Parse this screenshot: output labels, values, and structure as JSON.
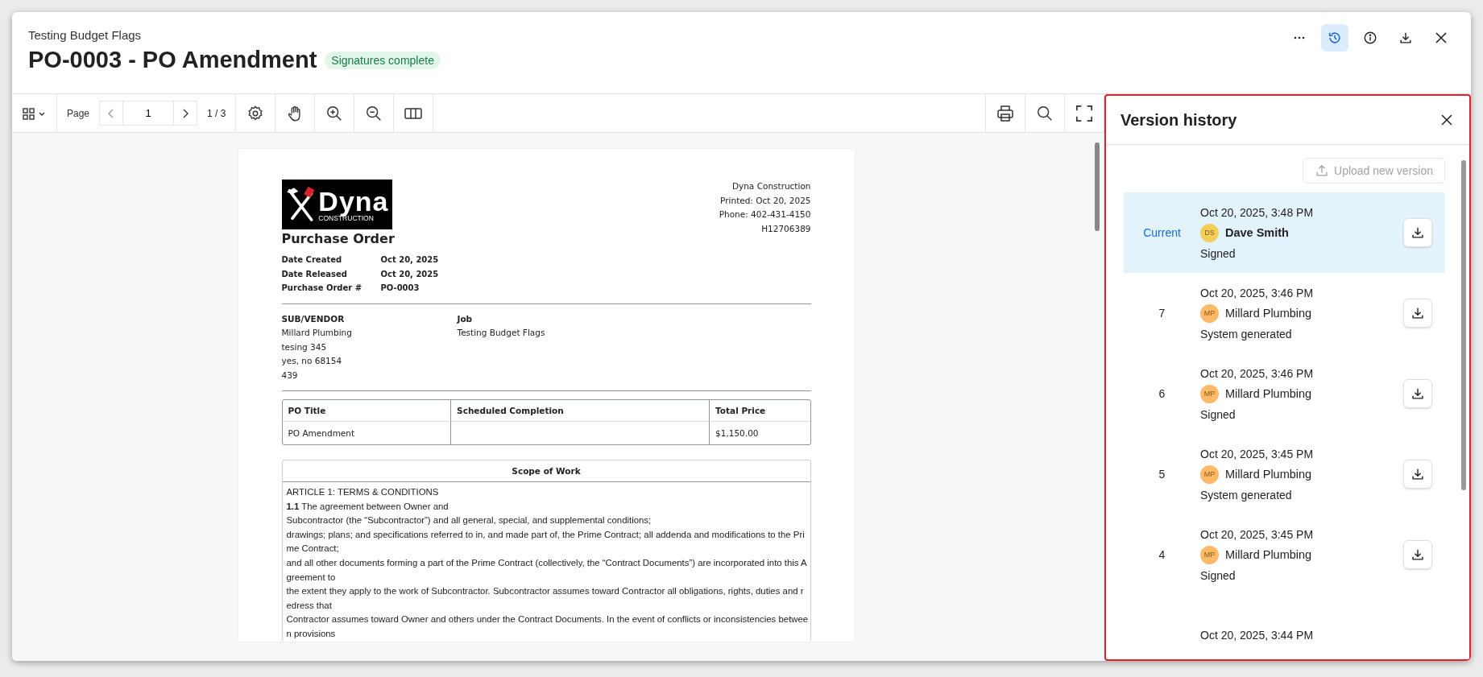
{
  "header": {
    "breadcrumb": "Testing Budget Flags",
    "title": "PO-0003 - PO Amendment",
    "status_badge": "Signatures complete"
  },
  "header_actions": [
    {
      "kind": "more",
      "selected": false
    },
    {
      "kind": "history",
      "selected": true
    },
    {
      "kind": "info",
      "selected": false
    },
    {
      "kind": "download",
      "selected": false
    },
    {
      "kind": "close",
      "selected": false
    }
  ],
  "toolbar": {
    "page_label": "Page",
    "page_value": "1",
    "page_count": "1 / 3"
  },
  "document": {
    "logo": {
      "name": "Dyna",
      "tagline": "CONSTRUCTION"
    },
    "company_lines": [
      "Dyna Construction",
      "Printed: Oct 20, 2025",
      "Phone: 402-431-4150",
      "H12706389"
    ],
    "heading": "Purchase Order",
    "meta": [
      {
        "label": "Date Created",
        "value": "Oct 20, 2025"
      },
      {
        "label": "Date Released",
        "value": "Oct 20, 2025"
      },
      {
        "label": "Purchase Order #",
        "value": "PO-0003"
      }
    ],
    "parties": [
      {
        "heading": "SUB/VENDOR",
        "lines": [
          "Millard Plumbing",
          "tesing 345",
          "yes, no 68154",
          "439"
        ]
      },
      {
        "heading": "Job",
        "lines": [
          "Testing Budget Flags"
        ]
      }
    ],
    "table": {
      "columns": [
        "PO Title",
        "Scheduled Completion",
        "Total Price"
      ],
      "rows": [
        [
          "PO Amendment",
          "",
          "$1,150.00"
        ]
      ]
    },
    "scope": {
      "title": "Scope of Work",
      "lines": [
        "ARTICLE 1:  TERMS & CONDITIONS",
        "**1.1**      The agreement between Owner and",
        "Subcontractor (the “Subcontractor”) and all general, special, and supplemental conditions;",
        "drawings; plans; and specifications referred to in, and made part of, the Prime Contract; all addenda and modifications to the Pri",
        "me Contract;",
        "and all other documents forming a part of the Prime Contract (collectively, the “Contract Documents”) are incorporated into this A",
        "greement to",
        "the extent they apply to the work of Subcontractor.  Subcontractor assumes toward Contractor all obligations, rights, duties and r",
        "edress that",
        "Contractor assumes toward Owner and others under the Contract Documents.  In the event of conflicts or inconsistencies betwee",
        "n provisions"
      ]
    }
  },
  "version_history": {
    "title": "Version history",
    "upload_button": "Upload new version",
    "upload_disabled": true,
    "versions": [
      {
        "label": "Current",
        "date": "Oct 20, 2025, 3:48 PM",
        "initials": "DS",
        "color": "#f2cf5b",
        "author": "Dave Smith",
        "status": "Signed",
        "selected": true
      },
      {
        "label": "7",
        "date": "Oct 20, 2025, 3:46 PM",
        "initials": "MP",
        "color": "#fdbb6a",
        "author": "Millard Plumbing",
        "status": "System generated",
        "selected": false
      },
      {
        "label": "6",
        "date": "Oct 20, 2025, 3:46 PM",
        "initials": "MP",
        "color": "#fdbb6a",
        "author": "Millard Plumbing",
        "status": "Signed",
        "selected": false
      },
      {
        "label": "5",
        "date": "Oct 20, 2025, 3:45 PM",
        "initials": "MP",
        "color": "#fdbb6a",
        "author": "Millard Plumbing",
        "status": "System generated",
        "selected": false
      },
      {
        "label": "4",
        "date": "Oct 20, 2025, 3:45 PM",
        "initials": "MP",
        "color": "#fdbb6a",
        "author": "Millard Plumbing",
        "status": "Signed",
        "selected": false
      },
      {
        "date": "Oct 20, 2025, 3:44 PM",
        "selected": false
      }
    ]
  }
}
